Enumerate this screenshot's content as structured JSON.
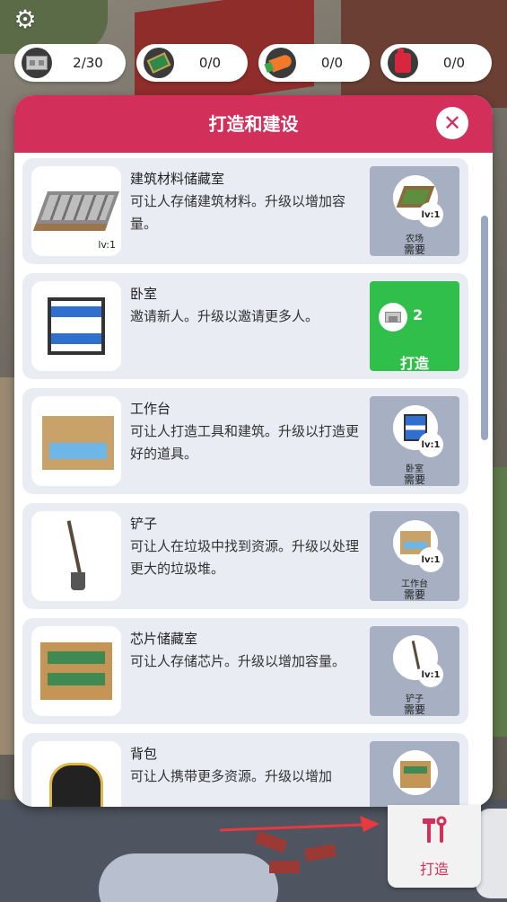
{
  "resources": [
    {
      "icon": "concrete-block-icon",
      "value": "2/30"
    },
    {
      "icon": "chip-icon",
      "value": "0/0"
    },
    {
      "icon": "carrot-icon",
      "value": "0/0"
    },
    {
      "icon": "fuel-can-icon",
      "value": "0/0"
    }
  ],
  "panel": {
    "title": "打造和建设",
    "close_icon": "close-icon"
  },
  "items": [
    {
      "name": "建筑材料储藏室",
      "description": "可让人存储建筑材料。升级以增加容量。",
      "level": "lv:1",
      "action": "requirement",
      "requirement": {
        "name": "农场",
        "level": "lv:1",
        "label": "需要"
      }
    },
    {
      "name": "卧室",
      "description": "邀请新人。升级以邀请更多人。",
      "level": "",
      "action": "build",
      "cost": {
        "icon": "concrete-block-icon",
        "amount": "2"
      },
      "build_label": "打造"
    },
    {
      "name": "工作台",
      "description": "可让人打造工具和建筑。升级以打造更好的道具。",
      "level": "",
      "action": "requirement",
      "requirement": {
        "name": "卧室",
        "level": "lv:1",
        "label": "需要"
      }
    },
    {
      "name": "铲子",
      "description": "可让人在垃圾中找到资源。升级以处理更大的垃圾堆。",
      "level": "",
      "action": "requirement",
      "requirement": {
        "name": "工作台",
        "level": "lv:1",
        "label": "需要"
      }
    },
    {
      "name": "芯片储藏室",
      "description": "可让人存储芯片。升级以增加容量。",
      "level": "",
      "action": "requirement",
      "requirement": {
        "name": "铲子",
        "level": "lv:1",
        "label": "需要"
      }
    },
    {
      "name": "背包",
      "description": "可让人携带更多资源。升级以增加",
      "level": "",
      "action": "requirement",
      "requirement": {
        "name": "",
        "level": "",
        "label": ""
      }
    }
  ],
  "craft_button": {
    "label": "打造",
    "icon": "hammer-wrench-icon"
  },
  "colors": {
    "header": "#d32f5b",
    "build_button": "#2fbf4a",
    "requirement_box": "#a6b0c2",
    "card": "#e9ecf3",
    "arrow": "#e8393f"
  }
}
